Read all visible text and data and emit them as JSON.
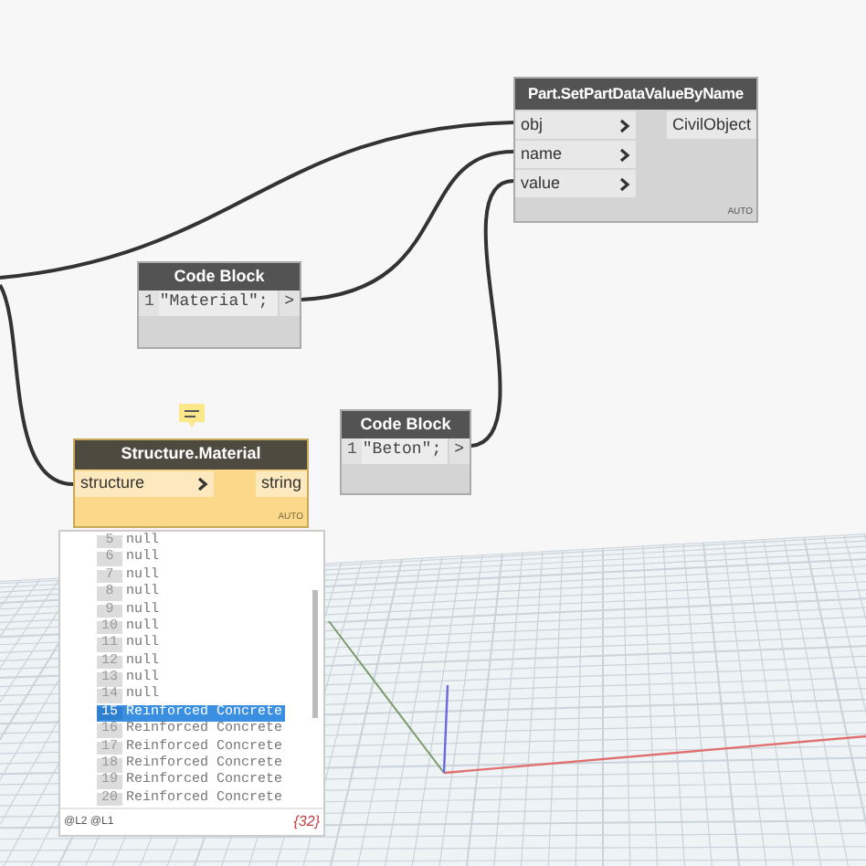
{
  "set_part_node": {
    "title": "Part.SetPartDataValueByName",
    "inputs": [
      "obj",
      "name",
      "value"
    ],
    "outputs": [
      "CivilObject"
    ],
    "lacing": "AUTO"
  },
  "code_blocks": [
    {
      "title": "Code Block",
      "line_number": "1",
      "code": "\"Material\";",
      "output_port": ">"
    },
    {
      "title": "Code Block",
      "line_number": "1",
      "code": "\"Beton\";",
      "output_port": ">"
    }
  ],
  "structure_node": {
    "title": "Structure.Material",
    "inputs": [
      "structure"
    ],
    "outputs": [
      "string"
    ],
    "lacing": "AUTO"
  },
  "preview": {
    "items": [
      {
        "index": "5",
        "value": "null",
        "selected": false
      },
      {
        "index": "6",
        "value": "null",
        "selected": false
      },
      {
        "index": "7",
        "value": "null",
        "selected": false
      },
      {
        "index": "8",
        "value": "null",
        "selected": false
      },
      {
        "index": "9",
        "value": "null",
        "selected": false
      },
      {
        "index": "10",
        "value": "null",
        "selected": false
      },
      {
        "index": "11",
        "value": "null",
        "selected": false
      },
      {
        "index": "12",
        "value": "null",
        "selected": false
      },
      {
        "index": "13",
        "value": "null",
        "selected": false
      },
      {
        "index": "14",
        "value": "null",
        "selected": false
      },
      {
        "index": "15",
        "value": "Reinforced Concrete",
        "selected": true
      },
      {
        "index": "16",
        "value": "Reinforced Concrete",
        "selected": false
      },
      {
        "index": "17",
        "value": "Reinforced Concrete",
        "selected": false
      },
      {
        "index": "18",
        "value": "Reinforced Concrete",
        "selected": false
      },
      {
        "index": "19",
        "value": "Reinforced Concrete",
        "selected": false
      },
      {
        "index": "20",
        "value": "Reinforced Concrete",
        "selected": false
      }
    ],
    "levels": "@L2 @L1",
    "count": "{32}"
  }
}
